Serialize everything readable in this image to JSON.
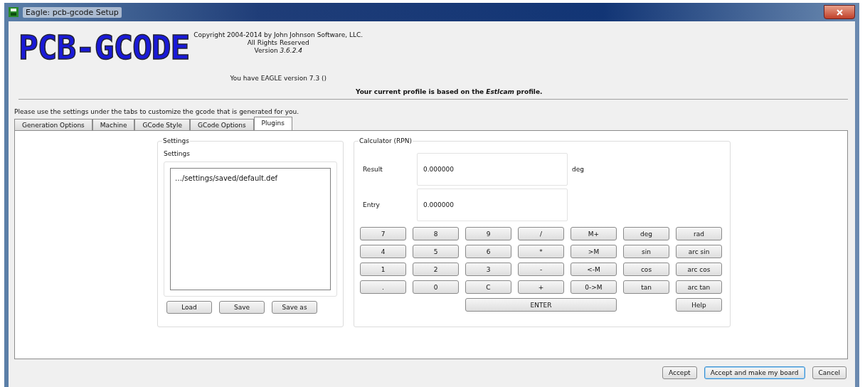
{
  "window": {
    "title": "Eagle: pcb-gcode Setup"
  },
  "header": {
    "logo": "PCB-GCODE",
    "copyright": "Copyright 2004-2014 by John Johnson Software, LLC.",
    "rights": "All Rights Reserved",
    "version": "Version *3.6.2.4*",
    "eagle_version": "You have EAGLE version 7.3 ()",
    "profile": "Your current profile is based on the *Estlcam* profile."
  },
  "instructions": "Please use the settings under the tabs to customize the gcode that is generated for you.",
  "tabs": [
    {
      "label": "Generation Options",
      "selected": false
    },
    {
      "label": "Machine",
      "selected": false
    },
    {
      "label": "GCode Style",
      "selected": false
    },
    {
      "label": "GCode Options",
      "selected": false
    },
    {
      "label": "Plugins",
      "selected": true
    }
  ],
  "settings": {
    "title": "Settings",
    "label": "Settings",
    "items": [
      "…/settings/saved/default.def"
    ],
    "buttons": [
      "Load",
      "Save",
      "Save as"
    ]
  },
  "calculator": {
    "title": "Calculator (RPN)",
    "result_label": "Result",
    "result": "0.000000",
    "unit": "deg",
    "entry_label": "Entry",
    "entry": "0.000000",
    "keys": [
      [
        "7",
        "8",
        "9",
        "/",
        "M+",
        "deg",
        "rad"
      ],
      [
        "4",
        "5",
        "6",
        "*",
        ">M",
        "sin",
        "arc sin"
      ],
      [
        "1",
        "2",
        "3",
        "-",
        "<-M",
        "cos",
        "arc cos"
      ],
      [
        ".",
        "0",
        "C",
        "+",
        "0->M",
        "tan",
        "arc tan"
      ]
    ],
    "enter": "ENTER",
    "help": "Help"
  },
  "footer_buttons": [
    {
      "label": "Accept",
      "default": false
    },
    {
      "label": "Accept and make my board",
      "default": true
    },
    {
      "label": "Cancel",
      "default": false
    }
  ]
}
